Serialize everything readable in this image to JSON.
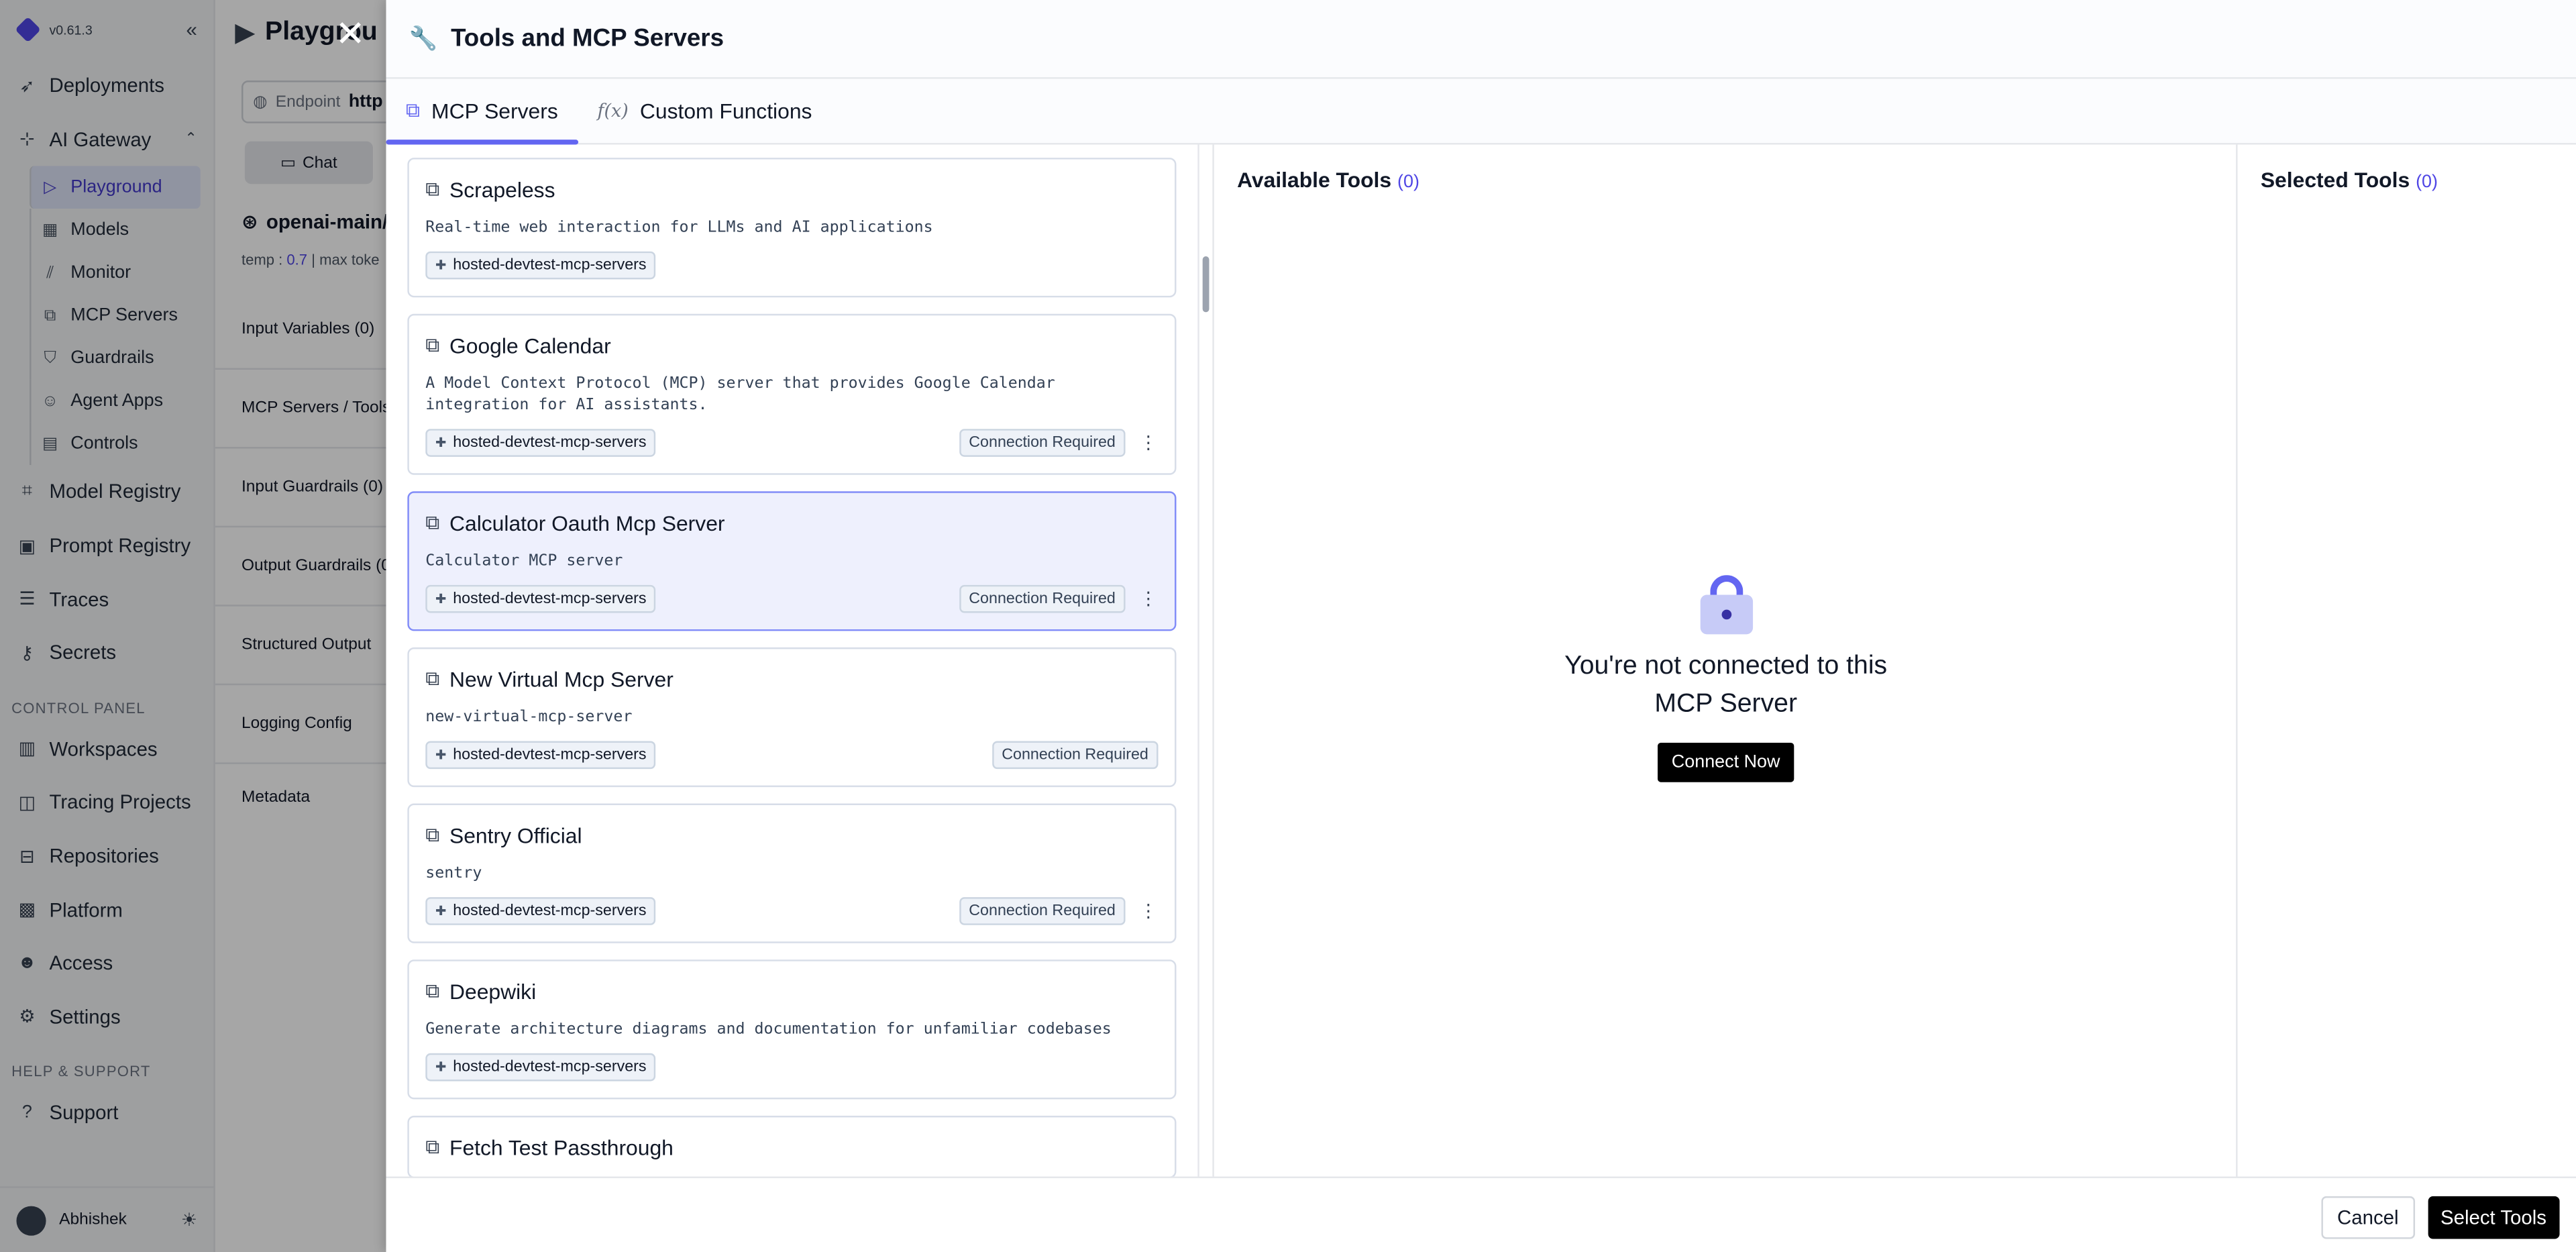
{
  "sidebar": {
    "version": "v0.61.3",
    "items": [
      {
        "label": "Deployments",
        "icon": "rocket-icon"
      },
      {
        "label": "AI Gateway",
        "icon": "gateway-icon"
      }
    ],
    "gateway_sub": [
      {
        "label": "Playground",
        "icon": "play-icon"
      },
      {
        "label": "Models",
        "icon": "table-icon"
      },
      {
        "label": "Monitor",
        "icon": "chart-icon"
      },
      {
        "label": "MCP Servers",
        "icon": "mcp-icon"
      },
      {
        "label": "Guardrails",
        "icon": "shield-icon"
      },
      {
        "label": "Agent Apps",
        "icon": "robot-icon"
      },
      {
        "label": "Controls",
        "icon": "file-icon"
      }
    ],
    "items2": [
      {
        "label": "Model Registry",
        "icon": "registry-icon"
      },
      {
        "label": "Prompt Registry",
        "icon": "prompt-icon"
      },
      {
        "label": "Traces",
        "icon": "traces-icon"
      },
      {
        "label": "Secrets",
        "icon": "key-icon"
      }
    ],
    "control_panel_label": "CONTROL PANEL",
    "control_items": [
      {
        "label": "Workspaces",
        "icon": "workspaces-icon"
      },
      {
        "label": "Tracing Projects",
        "icon": "tracing-icon"
      },
      {
        "label": "Repositories",
        "icon": "repo-icon"
      },
      {
        "label": "Platform",
        "icon": "platform-icon"
      },
      {
        "label": "Access",
        "icon": "access-icon"
      },
      {
        "label": "Settings",
        "icon": "gear-icon"
      }
    ],
    "help_label": "HELP & SUPPORT",
    "support": "Support",
    "user": "Abhishek"
  },
  "main": {
    "title": "Playgrou",
    "endpoint_label": "Endpoint",
    "endpoint_value": "http",
    "chat_tab": "Chat",
    "model": "openai-main/g",
    "params": {
      "temp_label": "temp :",
      "temp_value": "0.7",
      "max_label": "| max toke"
    },
    "config_rows": [
      "Input Variables (0)",
      "MCP Servers / Tools",
      "Input Guardrails (0)",
      "Output Guardrails (0",
      "Structured Output",
      "Logging Config",
      "Metadata"
    ]
  },
  "modal": {
    "title": "Tools and MCP Servers",
    "tabs": [
      {
        "label": "MCP Servers",
        "icon": "mcp-icon"
      },
      {
        "label": "Custom Functions",
        "icon": "function-icon"
      }
    ],
    "servers": [
      {
        "name": "Scrapeless",
        "desc": "Real-time web interaction for LLMs and AI applications",
        "group": "hosted-devtest-mcp-servers",
        "status": "",
        "menu": false,
        "selected": false
      },
      {
        "name": "Google Calendar",
        "desc": "A Model Context Protocol (MCP) server that provides Google Calendar integration for AI assistants.",
        "group": "hosted-devtest-mcp-servers",
        "status": "Connection Required",
        "menu": true,
        "selected": false
      },
      {
        "name": "Calculator Oauth Mcp Server",
        "desc": "Calculator MCP server",
        "group": "hosted-devtest-mcp-servers",
        "status": "Connection Required",
        "menu": true,
        "selected": true
      },
      {
        "name": "New Virtual Mcp Server",
        "desc": "new-virtual-mcp-server",
        "group": "hosted-devtest-mcp-servers",
        "status": "Connection Required",
        "menu": false,
        "selected": false
      },
      {
        "name": "Sentry Official",
        "desc": "sentry",
        "group": "hosted-devtest-mcp-servers",
        "status": "Connection Required",
        "menu": true,
        "selected": false
      },
      {
        "name": "Deepwiki",
        "desc": "Generate architecture diagrams and documentation for unfamiliar codebases",
        "group": "hosted-devtest-mcp-servers",
        "status": "",
        "menu": false,
        "selected": false
      },
      {
        "name": "Fetch Test Passthrough",
        "desc": "",
        "group": "",
        "status": "",
        "menu": false,
        "selected": false
      }
    ],
    "available_tools_label": "Available Tools",
    "available_tools_count": "(0)",
    "selected_tools_label": "Selected Tools",
    "selected_tools_count": "(0)",
    "not_connected_line1": "You're not connected to this",
    "not_connected_line2": "MCP Server",
    "connect_now": "Connect Now",
    "cancel": "Cancel",
    "select_tools": "Select Tools"
  },
  "colors": {
    "accent": "#4f46e5",
    "tab_underline": "#6366f1",
    "selected_card_bg": "#eef0fd"
  }
}
